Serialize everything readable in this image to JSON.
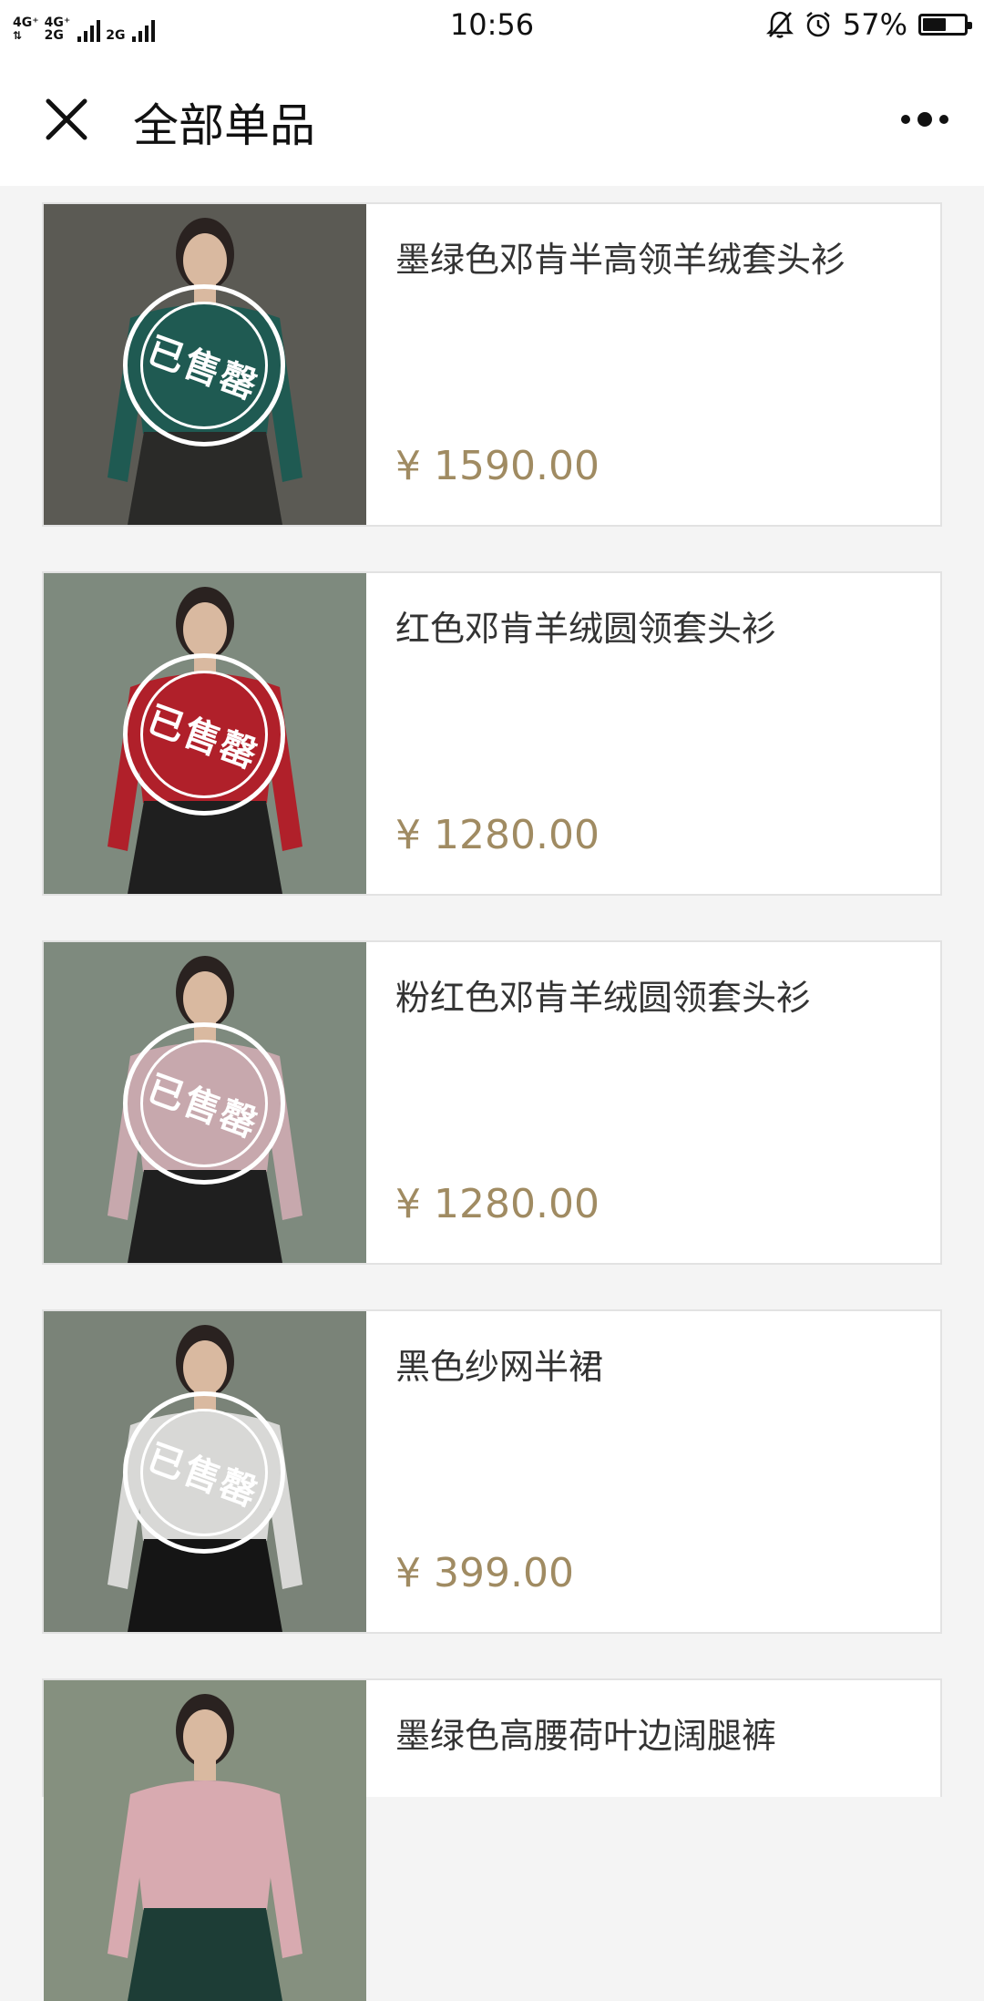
{
  "status_bar": {
    "network_1": "4G⁺",
    "network_2": "4G⁺",
    "network_3": "2G",
    "network_4": "2G",
    "time": "10:56",
    "battery": "57%",
    "battery_level": 0.57
  },
  "nav": {
    "title": "全部单品"
  },
  "products": [
    {
      "name": "墨绿色邓肯半高领羊绒套头衫",
      "price": "¥ 1590.00",
      "sold_out": "已售罄",
      "colors": {
        "bg": "#5b5a54",
        "top": "#1f5a52",
        "bottom": "#2a2a28"
      }
    },
    {
      "name": "红色邓肯羊绒圆领套头衫",
      "price": "¥ 1280.00",
      "sold_out": "已售罄",
      "colors": {
        "bg": "#7e8a7e",
        "top": "#b0202a",
        "bottom": "#1f1f1f"
      }
    },
    {
      "name": "粉红色邓肯羊绒圆领套头衫",
      "price": "¥ 1280.00",
      "sold_out": "已售罄",
      "colors": {
        "bg": "#7e8a7e",
        "top": "#c7a8ad",
        "bottom": "#1f1f1f"
      }
    },
    {
      "name": "黑色纱网半裙",
      "price": "¥ 399.00",
      "sold_out": "已售罄",
      "colors": {
        "bg": "#7a8378",
        "top": "#d8d8d6",
        "bottom": "#151515"
      }
    },
    {
      "name": "墨绿色高腰荷叶边阔腿裤",
      "price": "",
      "sold_out": "",
      "colors": {
        "bg": "#85907f",
        "top": "#d8aab0",
        "bottom": "#1d3d36"
      }
    }
  ]
}
